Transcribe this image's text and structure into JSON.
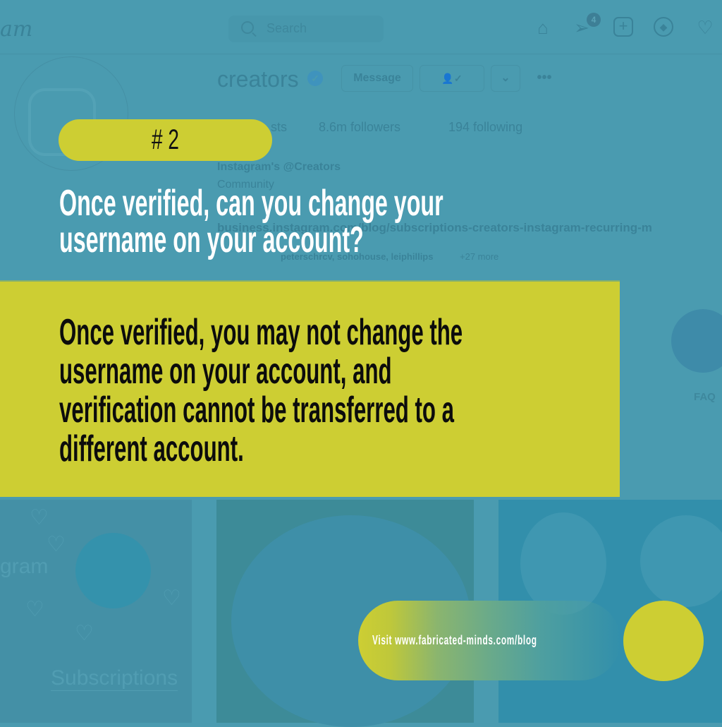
{
  "background_ui": {
    "logo_fragment": "am",
    "search_placeholder": "Search",
    "nav_icons": [
      "home-icon",
      "direct-icon",
      "new-post-icon",
      "explore-icon",
      "activity-icon"
    ],
    "direct_badge": "4",
    "username": "creators",
    "message_button": "Message",
    "stats": {
      "posts_fragment": "sts",
      "followers": "8.6m followers",
      "following": "194 following"
    },
    "bio_name": "Instagram's @Creators",
    "bio_category": "Community",
    "bio_link": "business.instagram.com/blog/subscriptions-creators-instagram-recurring-m",
    "followed_by_names": "peterschrcv, sohohouse, leiphillips",
    "followed_by_more": "+27 more",
    "highlight_label": "FAQ",
    "tile_text_gram": "gram",
    "tile_text_subscriptions": "Subscriptions"
  },
  "card": {
    "number_label": "# 2",
    "question": [
      "Once verified, can you change your",
      "username on your account?"
    ],
    "answer": [
      "Once verified, you may not change the",
      "username on your account, and",
      "verification cannot be transferred to a",
      "different account."
    ],
    "cta": "Visit www.fabricated-minds.com/blog"
  },
  "colors": {
    "background": "#4a9bb0",
    "accent": "#cdce33",
    "question_text": "#ffffff",
    "answer_text": "#0c0c0c"
  }
}
